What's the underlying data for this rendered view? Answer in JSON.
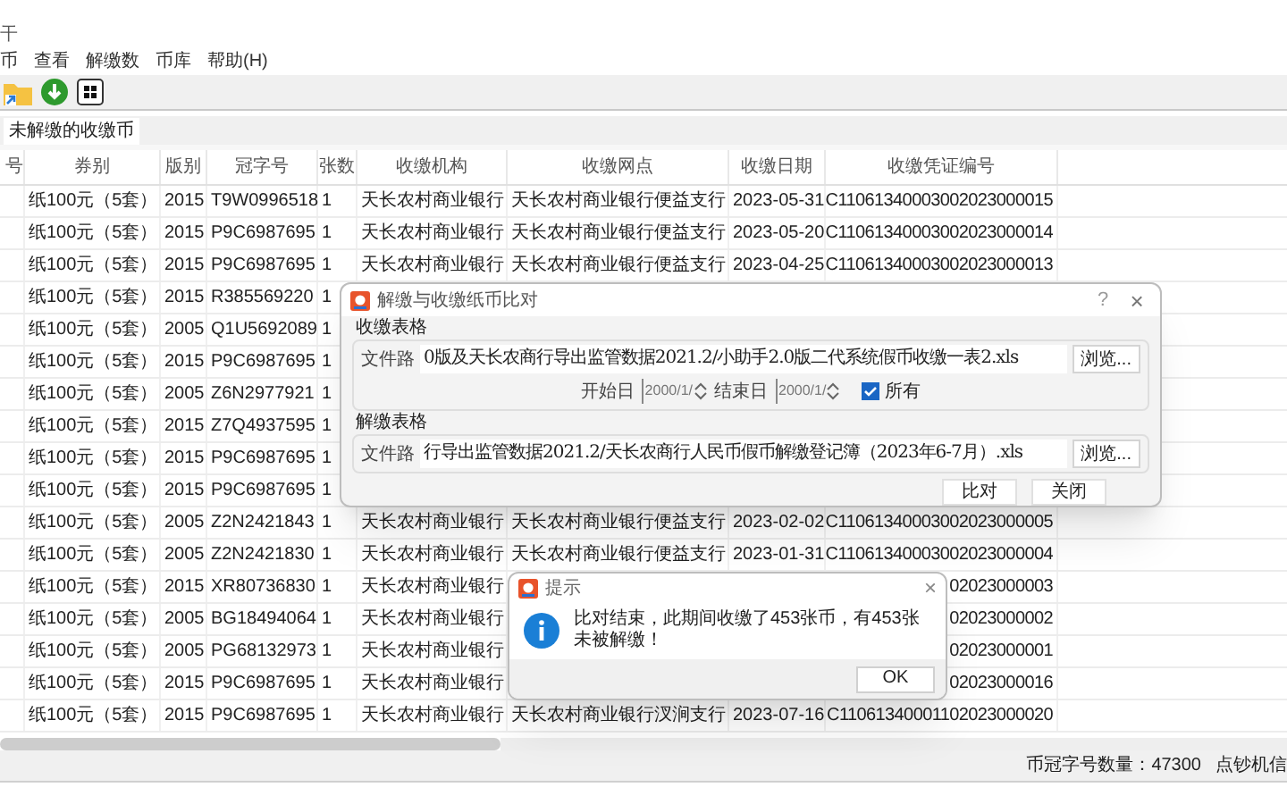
{
  "window": {
    "title": "干"
  },
  "menu": [
    "币",
    "查看",
    "解缴数",
    "币库",
    "帮助(H)"
  ],
  "tabs": [
    {
      "label": "未解缴的收缴币",
      "selected": true
    }
  ],
  "table": {
    "columns": [
      "号",
      "券别",
      "版别",
      "冠字号",
      "张数",
      "收缴机构",
      "收缴网点",
      "收缴日期",
      "收缴凭证编号"
    ],
    "rows": [
      {
        "denomination": "纸100元（5套）",
        "edition": "2015",
        "serial": "T9W0996518",
        "count": "1",
        "institution": "天长农村商业银行",
        "branch": "天长农村商业银行便益支行",
        "date": "2023-05-31",
        "voucher": "C11061340003002023000015"
      },
      {
        "denomination": "纸100元（5套）",
        "edition": "2015",
        "serial": "P9C6987695",
        "count": "1",
        "institution": "天长农村商业银行",
        "branch": "天长农村商业银行便益支行",
        "date": "2023-05-20",
        "voucher": "C11061340003002023000014"
      },
      {
        "denomination": "纸100元（5套）",
        "edition": "2015",
        "serial": "P9C6987695",
        "count": "1",
        "institution": "天长农村商业银行",
        "branch": "天长农村商业银行便益支行",
        "date": "2023-04-25",
        "voucher": "C11061340003002023000013"
      },
      {
        "denomination": "纸100元（5套）",
        "edition": "2015",
        "serial": "R385569220",
        "count": "1"
      },
      {
        "denomination": "纸100元（5套）",
        "edition": "2005",
        "serial": "Q1U5692089",
        "count": "1"
      },
      {
        "denomination": "纸100元（5套）",
        "edition": "2015",
        "serial": "P9C6987695",
        "count": "1"
      },
      {
        "denomination": "纸100元（5套）",
        "edition": "2005",
        "serial": "Z6N2977921",
        "count": "1"
      },
      {
        "denomination": "纸100元（5套）",
        "edition": "2015",
        "serial": "Z7Q4937595",
        "count": "1"
      },
      {
        "denomination": "纸100元（5套）",
        "edition": "2015",
        "serial": "P9C6987695",
        "count": "1"
      },
      {
        "denomination": "纸100元（5套）",
        "edition": "2015",
        "serial": "P9C6987695",
        "count": "1"
      },
      {
        "denomination": "纸100元（5套）",
        "edition": "2005",
        "serial": "Z2N2421843",
        "count": "1",
        "institution": "天长农村商业银行",
        "branch": "天长农村商业银行便益支行",
        "date": "2023-02-02",
        "voucher": "C11061340003002023000005"
      },
      {
        "denomination": "纸100元（5套）",
        "edition": "2005",
        "serial": "Z2N2421830",
        "count": "1",
        "institution": "天长农村商业银行",
        "branch": "天长农村商业银行便益支行",
        "date": "2023-01-31",
        "voucher": "C11061340003002023000004"
      },
      {
        "denomination": "纸100元（5套）",
        "edition": "2015",
        "serial": "XR80736830",
        "count": "1",
        "institution": "天长农村商业银行",
        "voucher": "02023000003"
      },
      {
        "denomination": "纸100元（5套）",
        "edition": "2005",
        "serial": "BG18494064",
        "count": "1",
        "institution": "天长农村商业银行",
        "voucher": "02023000002"
      },
      {
        "denomination": "纸100元（5套）",
        "edition": "2005",
        "serial": "PG68132973",
        "count": "1",
        "institution": "天长农村商业银行",
        "voucher": "02023000001"
      },
      {
        "denomination": "纸100元（5套）",
        "edition": "2015",
        "serial": "P9C6987695",
        "count": "1",
        "institution": "天长农村商业银行",
        "voucher": "02023000016"
      },
      {
        "denomination": "纸100元（5套）",
        "edition": "2015",
        "serial": "P9C6987695",
        "count": "1",
        "institution": "天长农村商业银行",
        "branch": "天长农村商业银行汊涧支行",
        "date": "2023-07-16",
        "voucher": "C11061340001102023000020"
      }
    ]
  },
  "status_bar": [
    "币冠字号数量：47300",
    "点钞机信"
  ],
  "compare_dialog": {
    "title": "解缴与收缴纸币比对",
    "help": "?",
    "close": "×",
    "collect_group": {
      "title": "收缴表格",
      "path_label": "文件路",
      "path": "0版及天长农商行导出监管数据2021.2/小助手2.0版二代系统假币收缴一表2.xls",
      "browse": "浏览...",
      "start_label": "开始日",
      "start": "2000/1/",
      "end_label": "结束日",
      "end": "2000/1/",
      "all": {
        "label": "所有",
        "checked": true
      }
    },
    "deliver_group": {
      "title": "解缴表格",
      "path_label": "文件路",
      "path": "行导出监管数据2021.2/天长农商行人民币假币解缴登记簿（2023年6-7月）.xls",
      "browse": "浏览..."
    },
    "buttons": [
      "比对",
      "关闭"
    ]
  },
  "message_box": {
    "title": "提示",
    "close": "×",
    "message": "比对结束，此期间收缴了453张币，有453张未被解缴！",
    "button": "OK"
  }
}
